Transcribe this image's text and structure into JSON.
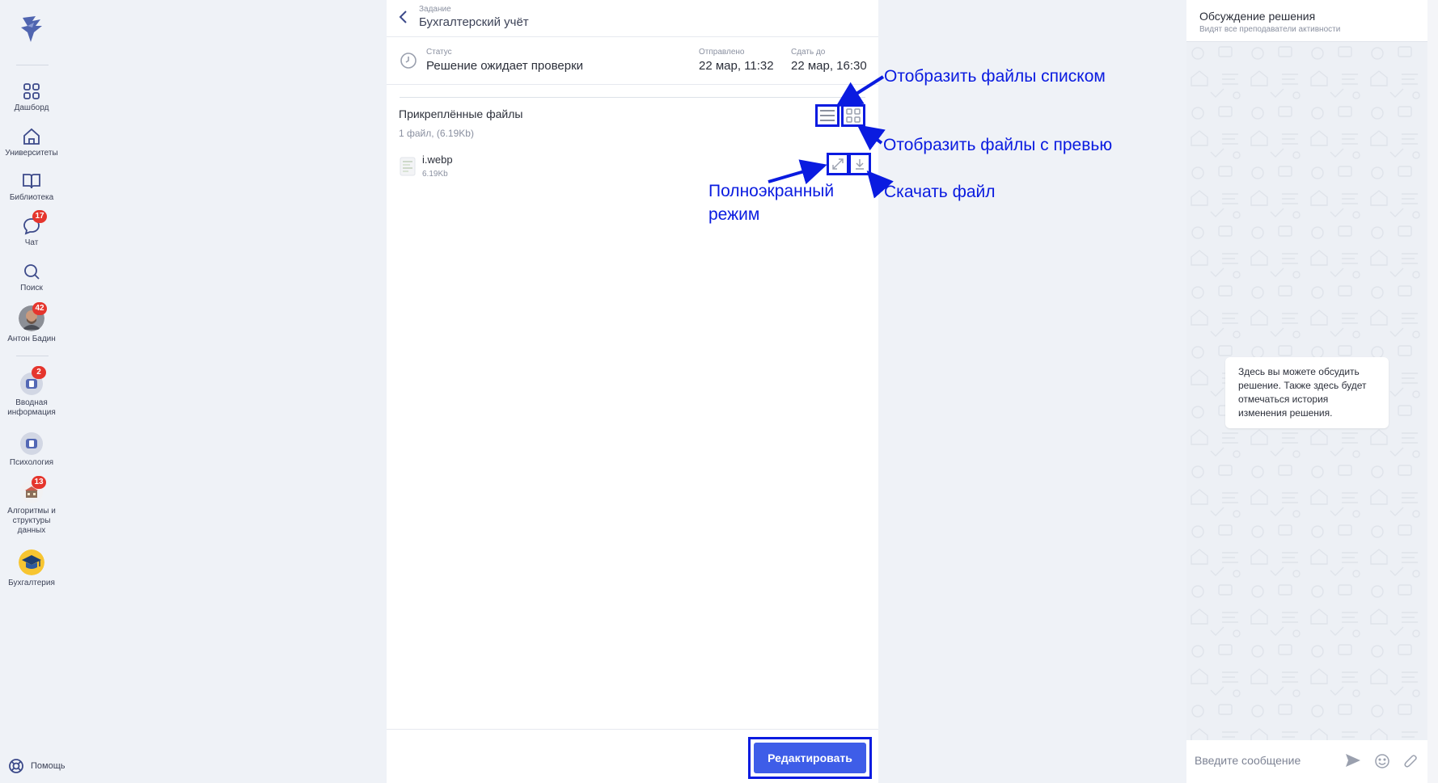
{
  "sidebar": {
    "items": [
      {
        "label": "Дашборд"
      },
      {
        "label": "Университеты"
      },
      {
        "label": "Библиотека"
      },
      {
        "label": "Чат",
        "badge": "17"
      },
      {
        "label": "Поиск"
      },
      {
        "label": "Антон Бадин",
        "badge": "42"
      },
      {
        "label": "Вводная информация",
        "badge": "2"
      },
      {
        "label": "Психология"
      },
      {
        "label": "Алгоритмы и структуры данных",
        "badge": "13"
      },
      {
        "label": "Бухгалтерия"
      }
    ],
    "help": "Помощь"
  },
  "header": {
    "sup": "Задание",
    "title": "Бухгалтерский учёт"
  },
  "status": {
    "label": "Статус",
    "value": "Решение ожидает проверки",
    "sent_label": "Отправлено",
    "sent_value": "22 мар, 11:32",
    "due_label": "Сдать до",
    "due_value": "22 мар, 16:30"
  },
  "files": {
    "title": "Прикреплённые файлы",
    "meta": "1 файл, (6.19Kb)",
    "items": [
      {
        "name": "i.webp",
        "size": "6.19Kb"
      }
    ]
  },
  "footer": {
    "edit_label": "Редактировать"
  },
  "annotations": {
    "list_view": "Отобразить файлы списком",
    "preview_view": "Отобразить файлы с превью",
    "fullscreen_line1": "Полноэкранный",
    "fullscreen_line2": "режим",
    "download": "Скачать файл"
  },
  "chat": {
    "title": "Обсуждение решения",
    "subtitle": "Видят все преподаватели активности",
    "bubble": "Здесь вы можете обсудить решение. Также здесь будет отмечаться история изменения решения.",
    "placeholder": "Введите сообщение"
  },
  "colors": {
    "accent": "#3e5de8",
    "annotation": "#0a1be0",
    "badge": "#e5352d"
  }
}
